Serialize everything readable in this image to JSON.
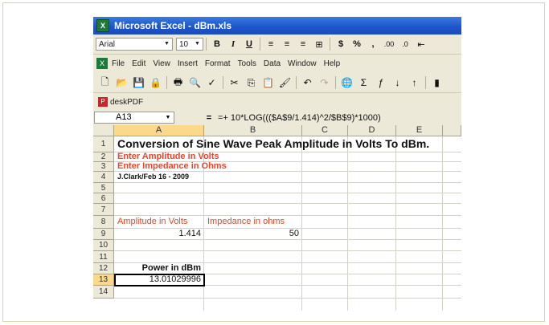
{
  "window": {
    "title": "Microsoft Excel - dBm.xls",
    "app_icon": "excel-icon"
  },
  "format_toolbar": {
    "font_name": "Arial",
    "font_size": "10",
    "bold": "B",
    "italic": "I",
    "underline": "U",
    "currency": "$",
    "percent": "%",
    "comma": ",",
    "inc_decimal": ".00",
    "dec_decimal": ".0",
    "indent": "⇤"
  },
  "menu": {
    "items": [
      "File",
      "Edit",
      "View",
      "Insert",
      "Format",
      "Tools",
      "Data",
      "Window",
      "Help"
    ]
  },
  "pdf_toolbar": {
    "label": "deskPDF"
  },
  "formula_bar": {
    "cell_ref": "A13",
    "equals": "=",
    "formula": "=+ 10*LOG((($A$9/1.414)^2/$B$9)*1000)"
  },
  "columns": [
    "A",
    "B",
    "C",
    "D",
    "E"
  ],
  "rows": [
    "1",
    "2",
    "3",
    "4",
    "5",
    "6",
    "7",
    "8",
    "9",
    "10",
    "11",
    "12",
    "13",
    "14"
  ],
  "cells": {
    "a1": "Conversion of Sine Wave Peak Amplitude in Volts To dBm.",
    "a2": "Enter Amplitude in Volts",
    "a3": "Enter Impedance in Ohms",
    "a4": "J.Clark/Feb 16 - 2009",
    "a8": "Amplitude in Volts",
    "b8": "Impedance in ohms",
    "a9": "1.414",
    "b9": "50",
    "a12": "Power in dBm",
    "a13": "13.01029996"
  },
  "colors": {
    "accent_red": "#e2492b",
    "title_bar": "#1c54c8",
    "selection_header": "#fbd98a"
  }
}
